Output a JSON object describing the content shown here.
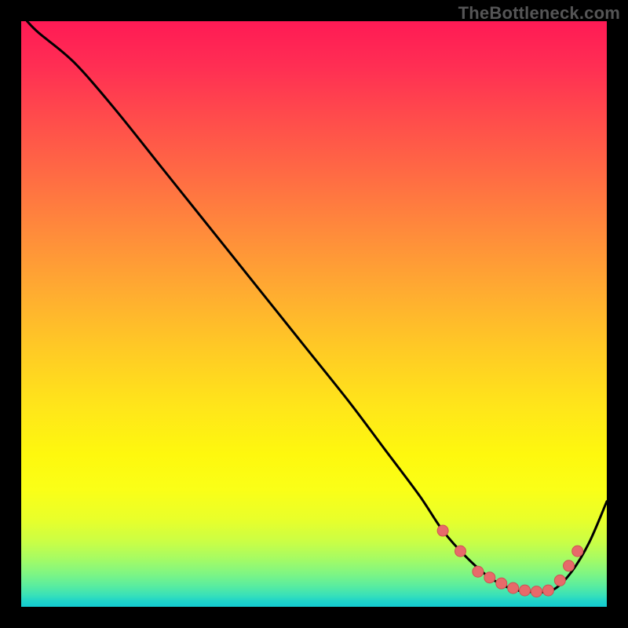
{
  "watermark": "TheBottleneck.com",
  "colors": {
    "frame_bg": "#000000",
    "curve_stroke": "#000000",
    "marker_fill": "#e76a6a",
    "marker_stroke": "#cf5252"
  },
  "chart_data": {
    "type": "line",
    "title": "",
    "xlabel": "",
    "ylabel": "",
    "xlim": [
      0,
      100
    ],
    "ylim": [
      0,
      100
    ],
    "grid": false,
    "legend": false,
    "series": [
      {
        "name": "bottleneck-curve",
        "x": [
          1,
          3,
          9,
          16,
          24,
          32,
          40,
          48,
          56,
          62,
          68,
          72,
          76,
          80,
          84,
          88,
          91,
          94,
          97,
          100
        ],
        "y": [
          100,
          98,
          93,
          85,
          75,
          65,
          55,
          45,
          35,
          27,
          19,
          13,
          8.5,
          5,
          3,
          2.5,
          3,
          6,
          11,
          18
        ]
      }
    ],
    "markers": [
      {
        "x": 72,
        "y": 13
      },
      {
        "x": 75,
        "y": 9.5
      },
      {
        "x": 78,
        "y": 6
      },
      {
        "x": 80,
        "y": 5
      },
      {
        "x": 82,
        "y": 4
      },
      {
        "x": 84,
        "y": 3.2
      },
      {
        "x": 86,
        "y": 2.8
      },
      {
        "x": 88,
        "y": 2.6
      },
      {
        "x": 90,
        "y": 2.8
      },
      {
        "x": 92,
        "y": 4.5
      },
      {
        "x": 93.5,
        "y": 7
      },
      {
        "x": 95,
        "y": 9.5
      }
    ]
  }
}
